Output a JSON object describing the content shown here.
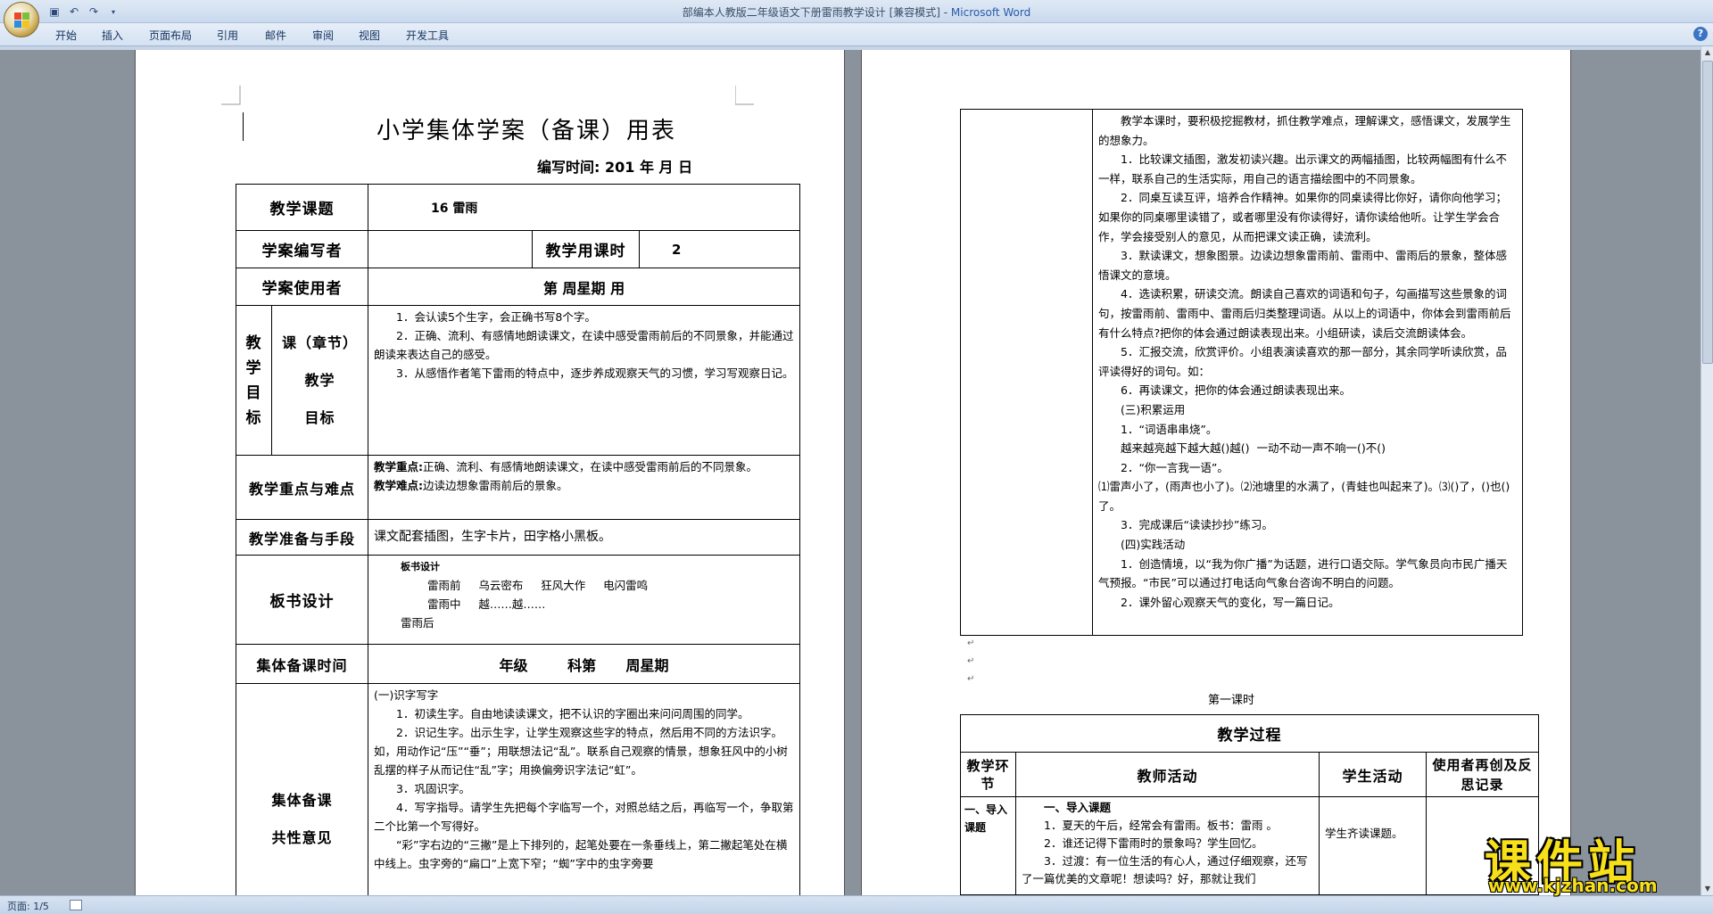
{
  "window": {
    "title": "部编本人教版二年级语文下册雷雨教学设计 [兼容模式] - ",
    "app": "Microsoft Word"
  },
  "ribbon": {
    "tabs": [
      "开始",
      "插入",
      "页面布局",
      "引用",
      "邮件",
      "审阅",
      "视图",
      "开发工具"
    ]
  },
  "status": {
    "page": "页面: 1/5"
  },
  "watermark": {
    "text": "课件站",
    "url": "www.kjzhan.com"
  },
  "page1": {
    "title": "小学集体学案（备课）用表",
    "date": "编写时间: 201  年   月   日",
    "rows": {
      "topic_label": "教学课题",
      "topic_value": "16   雷雨",
      "author_label": "学案编写者",
      "hours_label": "教学用课时",
      "hours_value": "2",
      "user_label": "学案使用者",
      "user_value": "第      周星期    用",
      "goals_outer": [
        "教",
        "学",
        "目",
        "标"
      ],
      "goals_inner": [
        "课（章节）",
        "教学",
        "目标"
      ],
      "goals": [
        "1．会认读5个生字，会正确书写8个字。",
        "2．正确、流利、有感情地朗读课文，在读中感受雷雨前后的不同景象，并能通过朗读来表达自己的感受。",
        "3．从感悟作者笔下雷雨的特点中，逐步养成观察天气的习惯，学习写观察日记。"
      ],
      "key_label": "教学重点与难点",
      "key_point_label": "教学重点:",
      "key_point": "正确、流利、有感情地朗读课文，在读中感受雷雨前后的不同景象。",
      "difficulty_label": "教学难点:",
      "difficulty": "边读边想象雷雨前后的景象。",
      "prep_label": "教学准备与手段",
      "prep_value": "课文配套插图，生字卡片，田字格小黑板。",
      "board_label": "板书设计",
      "board": [
        "板书设计",
        "雷雨前     乌云密布     狂风大作     电闪雷鸣",
        "雷雨中     越……越……",
        "雷雨后"
      ],
      "collective_time_label": "集体备课时间",
      "collective_time_value": "年级        科第      周星期",
      "opinion_label": [
        "集体备课",
        "共性意见"
      ],
      "opinion": [
        "(一)识字写字",
        "1．初读生字。自由地读读课文，把不认识的字圈出来问问周围的同学。",
        "2．识记生字。出示生字，让学生观察这些字的特点，然后用不同的方法识字。如，用动作记“压”“垂”；用联想法记“乱”。联系自己观察的情景，想象狂风中的小树乱摆的样子从而记住“乱”字；用换偏旁识字法记“虹”。",
        "3．巩固识字。",
        "4．写字指导。请学生先把每个字临写一个，对照总结之后，再临写一个，争取第二个比第一个写得好。",
        "“彩”字右边的“三撇”是上下排列的，起笔处要在一条垂线上，第二撇起笔处在横中线上。虫字旁的“扁口”上宽下窄；“蜘”字中的虫字旁要"
      ]
    }
  },
  "page2": {
    "top_cell": [
      "教学本课时，要积极挖掘教材，抓住教学难点，理解课文，感悟课文，发展学生的想象力。",
      "1．比较课文插图，激发初读兴趣。出示课文的两幅插图，比较两幅图有什么不一样，联系自己的生活实际，用自己的语言描绘图中的不同景象。",
      "2．同桌互读互评，培养合作精神。如果你的同桌读得比你好，请你向他学习；如果你的同桌哪里读错了，或者哪里没有你读得好，请你读给他听。让学生学会合作，学会接受别人的意见，从而把课文读正确，读流利。",
      "3．默读课文，想象图景。边读边想象雷雨前、雷雨中、雷雨后的景象，整体感悟课文的意境。",
      "4．选读积累，研读交流。朗读自己喜欢的词语和句子，勾画描写这些景象的词句，按雷雨前、雷雨中、雷雨后归类整理词语。从以上的词语中，你体会到雷雨前后有什么特点?把你的体会通过朗读表现出来。小组研读，读后交流朗读体会。",
      "5．汇报交流，欣赏评价。小组表演读喜欢的那一部分，其余同学听读欣赏，品评读得好的词句。如：",
      "6．再读课文，把你的体会通过朗读表现出来。",
      "(三)积累运用",
      "1．“词语串串烧”。",
      "越来越亮越下越大越()越()  一动不动一声不响一()不()",
      "2．“你一言我一语”。",
      "⑴雷声小了，(雨声也小了)。⑵池塘里的水满了，(青蛙也叫起来了)。⑶()了，()也()了。",
      "3．完成课后“读读抄抄”练习。",
      "(四)实践活动",
      "1．创造情境，以“我为你广播”为话题，进行口语交际。学气象员向市民广播天气预报。“市民”可以通过打电话向气象台咨询不明白的问题。",
      "2．课外留心观察天气的变化，写一篇日记。"
    ],
    "lesson_label": "第一课时",
    "process_title": "教学过程",
    "headers": [
      "教学环节",
      "教师活动",
      "学生活动",
      "使用者再创及反思记录"
    ],
    "row1_step": "一、导入课题",
    "row1_teacher": [
      "一、导入课题",
      "1．夏天的午后，经常会有雷雨。板书：雷雨 。",
      "2．谁还记得下雷雨时的景象吗？学生回忆。",
      "3．过渡：有一位生活的有心人，通过仔细观察，还写了一篇优美的文章呢！想读吗？好，那就让我们"
    ],
    "row1_student": "学生齐读课题。"
  }
}
